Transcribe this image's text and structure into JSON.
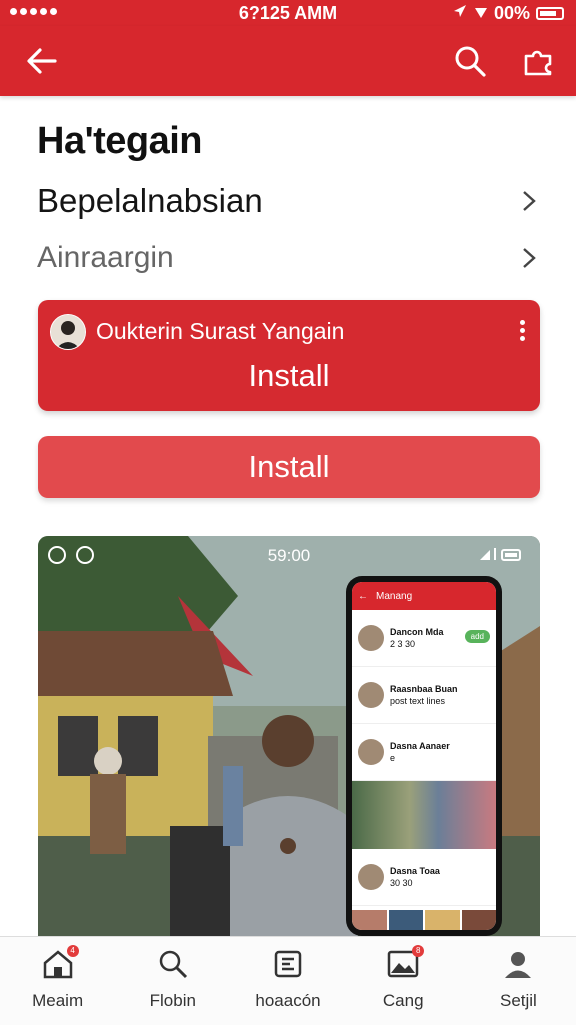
{
  "status_bar": {
    "time": "6?125 AMM",
    "battery": "00%"
  },
  "header": {
    "back_icon": "arrow-left-icon",
    "search_icon": "search-icon",
    "extension_icon": "puzzle-icon"
  },
  "page": {
    "title": "Ha'tegain",
    "row1_label": "Bepelalnabsian",
    "row2_label": "Ainraargin"
  },
  "promo_card": {
    "title": "Oukterin Surast Yangain",
    "install_label": "Install"
  },
  "install_button_label": "Install",
  "media": {
    "overlay_time": "59:00",
    "phone": {
      "bar_title": "Manang",
      "items": [
        {
          "name": "Dancon Mda",
          "sub": "2 3 30",
          "tag": "add"
        },
        {
          "name": "Raasnbaa Buan",
          "sub": "post text lines"
        },
        {
          "name": "Dasna Aanaer",
          "sub": "e"
        },
        {
          "name": "Dasna Toaa",
          "sub": "30 30"
        }
      ]
    }
  },
  "tabbar": {
    "items": [
      {
        "label": "Meaim",
        "icon": "home-icon",
        "badge": true
      },
      {
        "label": "Flobin",
        "icon": "search-icon",
        "badge": false
      },
      {
        "label": "hoaacón",
        "icon": "app-icon",
        "badge": false
      },
      {
        "label": "Cang",
        "icon": "image-icon",
        "badge": true
      },
      {
        "label": "Setjil",
        "icon": "profile-icon",
        "badge": false
      }
    ]
  },
  "colors": {
    "primary": "#d7272d",
    "secondary": "#e24a4d"
  }
}
